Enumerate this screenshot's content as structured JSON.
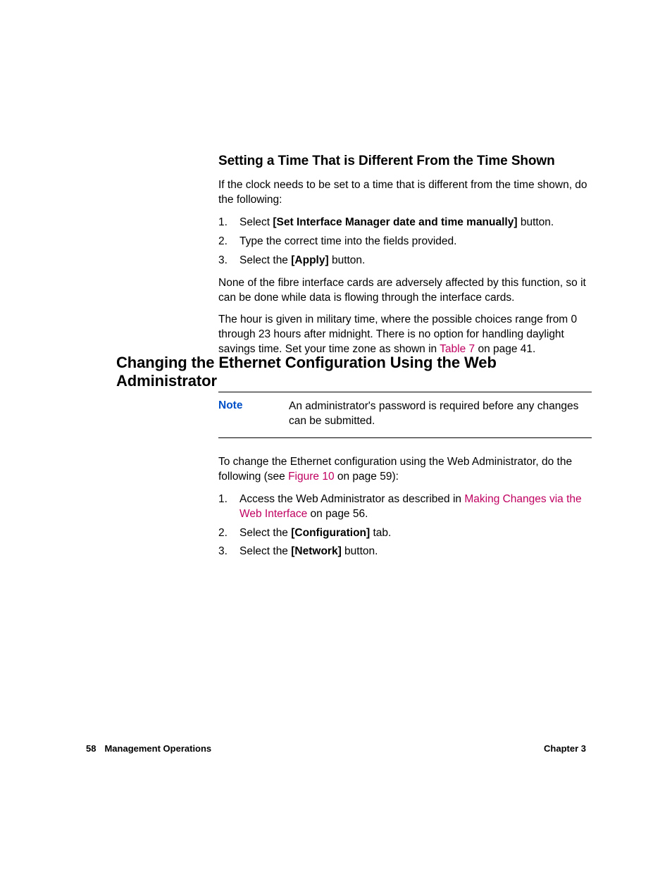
{
  "section1": {
    "heading": "Setting a Time That is Different From the Time Shown",
    "intro": "If the clock needs to be set to a time that is different from the time shown, do the following:",
    "steps": [
      {
        "num": "1.",
        "pre": "Select ",
        "bold": "[Set Interface Manager date and time manually]",
        "post": " button."
      },
      {
        "num": "2.",
        "pre": "Type the correct time into the fields provided.",
        "bold": "",
        "post": ""
      },
      {
        "num": "3.",
        "pre": "Select the ",
        "bold": "[Apply]",
        "post": "  button."
      }
    ],
    "after1": "None of the fibre interface cards are adversely affected by this function, so it can be done while data is flowing through the interface cards.",
    "after2_pre": "The hour is given in military time, where the possible choices range from 0 through 23 hours after midnight. There is no option for handling daylight savings time. Set your time zone as shown in ",
    "after2_link": "Table 7",
    "after2_post": " on page 41."
  },
  "section2": {
    "heading": "Changing the Ethernet Configuration Using the Web Administrator",
    "note_label": "Note",
    "note_text": "An administrator's password is required before any changes can be submitted.",
    "intro_pre": "To change the Ethernet configuration using the Web Administrator, do the following (see ",
    "intro_link": "Figure 10",
    "intro_post": " on page 59):",
    "steps": [
      {
        "num": "1.",
        "pre": "Access the Web Administrator as described in  ",
        "link": "Making Changes via the Web Interface",
        "post": " on page 56."
      },
      {
        "num": "2.",
        "pre": "Select the ",
        "bold": "[Configuration]",
        "post": " tab."
      },
      {
        "num": "3.",
        "pre": "Select the ",
        "bold": "[Network]",
        "post": "  button."
      }
    ]
  },
  "footer": {
    "page": "58",
    "section": "Management Operations",
    "chapter": "Chapter 3"
  }
}
